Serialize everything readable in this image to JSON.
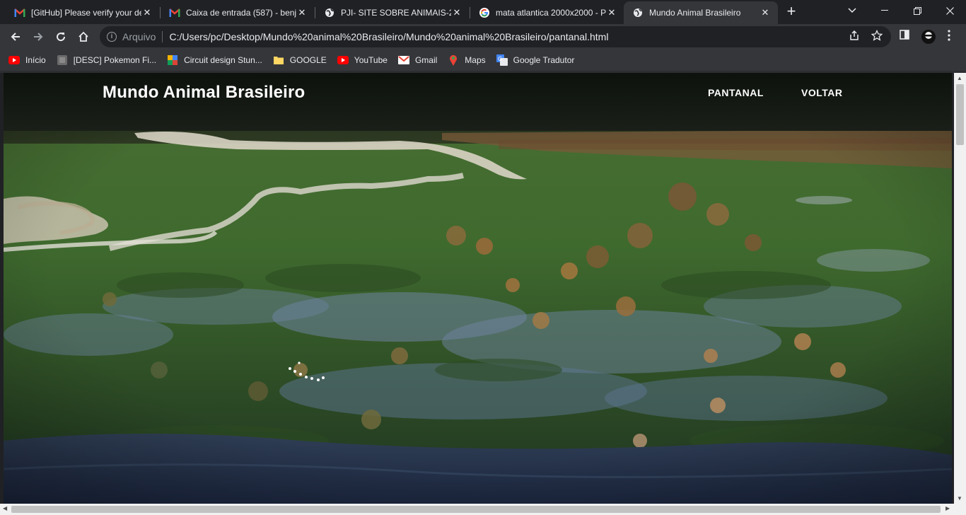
{
  "tabs": [
    {
      "title": "[GitHub] Please verify your de",
      "icon": "gmail-icon"
    },
    {
      "title": "Caixa de entrada (587) - benj",
      "icon": "gmail-icon"
    },
    {
      "title": "PJI- SITE SOBRE ANIMAIS-202",
      "icon": "globe-icon"
    },
    {
      "title": "mata atlantica 2000x2000 - P",
      "icon": "google-icon"
    },
    {
      "title": "Mundo Animal Brasileiro",
      "icon": "globe-icon"
    }
  ],
  "toolbar": {
    "scheme_label": "Arquivo",
    "url": "C:/Users/pc/Desktop/Mundo%20animal%20Brasileiro/Mundo%20animal%20Brasileiro/pantanal.html"
  },
  "bookmarks": [
    {
      "label": "Início",
      "icon": "youtube-icon"
    },
    {
      "label": "[DESC] Pokemon Fi...",
      "icon": "pokemon-icon"
    },
    {
      "label": "Circuit design Stun...",
      "icon": "circuit-icon"
    },
    {
      "label": "GOOGLE",
      "icon": "folder-icon"
    },
    {
      "label": "YouTube",
      "icon": "youtube-icon"
    },
    {
      "label": "Gmail",
      "icon": "gmail-icon"
    },
    {
      "label": "Maps",
      "icon": "maps-icon"
    },
    {
      "label": "Google Tradutor",
      "icon": "translate-icon"
    }
  ],
  "site": {
    "brand": "Mundo Animal Brasileiro",
    "nav": [
      {
        "label": "PANTANAL"
      },
      {
        "label": "VOLTAR"
      }
    ],
    "hero_image": "pantanal-wetland-aerial-photo"
  },
  "colors": {
    "tabbar": "#202124",
    "toolbar": "#35363a",
    "gmail_red": "#ea4335",
    "youtube_red": "#ff0000"
  }
}
